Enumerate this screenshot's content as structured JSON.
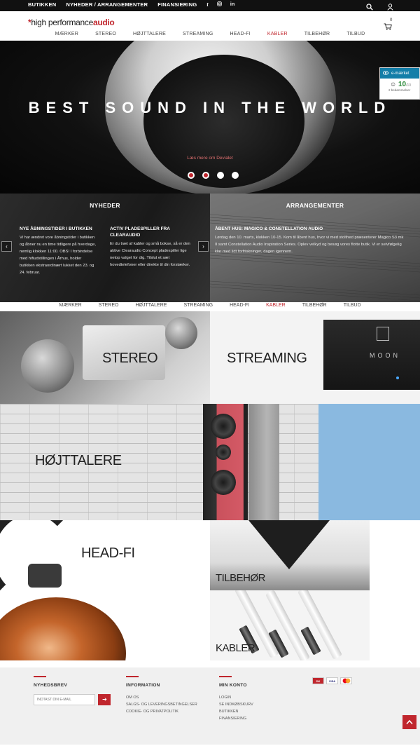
{
  "topbar": {
    "links": [
      "BUTIKKEN",
      "NYHEDER / ARRANGEMENTER",
      "FINANSIERING"
    ],
    "social": [
      "facebook-icon",
      "instagram-icon",
      "linkedin-icon"
    ]
  },
  "header": {
    "logo_prefix": "high performance",
    "logo_suffix": "audio",
    "cart_count": "0",
    "nav": [
      "MÆRKER",
      "STEREO",
      "HØJTTALERE",
      "STREAMING",
      "HEAD-FI",
      "KABLER",
      "TILBEHØR",
      "TILBUD"
    ],
    "active_nav": "KABLER"
  },
  "hero": {
    "title": "BEST SOUND IN THE WORLD",
    "link": "Læs mere om Devialet",
    "slides": 4,
    "active_slide": 1
  },
  "emaerket": {
    "label": "e-mærket",
    "score": "10",
    "score_max": "/10",
    "reviews": "2 bedømmelser"
  },
  "news": {
    "title": "NYHEDER",
    "items": [
      {
        "title": "NYE ÅBNINGSTIDER I BUTIKKEN",
        "body": "Vi har ændret vore åbningstider i butikken og åbner nu en time tidligere på hverdage, nemlig klokken 11:00. OBS! I forbindelse med hifiudstillingen i Århus, holder butikken ekstraordinært lukket den 23. og 24. februar."
      },
      {
        "title": "ACTIV PLADESPILLER FRA CLEARAUDIO",
        "body": "Er du træt af kabler og små bokse, så er den aktive Clearaudio Concept pladespiller lige netop valget for dig. Tilslut et sæt hovedtelefoner eller direkte til din forstærker."
      }
    ]
  },
  "events": {
    "title": "ARRANGEMENTER",
    "items": [
      {
        "title": "ÅBENT HUS: MAGICO & CONSTELLATION AUDIO",
        "body": "Lørdag den 10. marts, klokken 10-15. Kom til åbent hus, hvor vi med stolthed præsenterer Magico S3 mk II samt Constellation Audio Inspiration Series. Oplev velkyd og besøg vores flotte butik. Vi er selvfølgelig klar med lidt forfriskninger, dagen igennem."
      }
    ]
  },
  "categories": {
    "stereo": "STEREO",
    "streaming": "STREAMING",
    "hojttalere": "HØJTTALERE",
    "headfi": "HEAD-FI",
    "tilbehor": "TILBEHØR",
    "kabler": "KABLER",
    "moon_brand": "MOON"
  },
  "footer": {
    "newsletter": {
      "title": "NYHEDSBREV",
      "placeholder": "INDTAST DIN E-MAIL"
    },
    "information": {
      "title": "INFORMATION",
      "links": [
        "OM OS",
        "SALGS- OG LEVERINGSBETINGELSER",
        "COOKIE- OG PRIVATPOLITIK"
      ]
    },
    "account": {
      "title": "MIN KONTO",
      "links": [
        "LOGIN",
        "SE INDKØBSKURV",
        "BUTIKKEN",
        "FINANSIERING"
      ]
    },
    "payment_cards": [
      "DK",
      "VISA",
      "MC"
    ]
  },
  "colors": {
    "brand_red": "#c0262d",
    "emark_blue": "#137ea8"
  }
}
